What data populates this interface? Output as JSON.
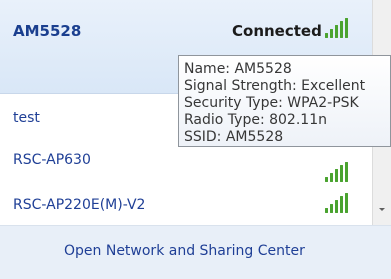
{
  "connected_network": {
    "name": "AM5528",
    "status": "Connected"
  },
  "tooltip": {
    "name": "Name: AM5528",
    "signal_strength": "Signal Strength: Excellent",
    "security_type": "Security Type: WPA2-PSK",
    "radio_type": "Radio Type: 802.11n",
    "ssid": "SSID: AM5528"
  },
  "networks": [
    {
      "name": "test"
    },
    {
      "name": "RSC-AP630"
    },
    {
      "name": "RSC-AP220E(M)-V2"
    }
  ],
  "footer": {
    "link_text": "Open Network and Sharing Center"
  },
  "icons": {
    "signal": "signal-strength-icon",
    "scroll": "chevron-down-icon"
  },
  "colors": {
    "link_blue": "#1f3f96",
    "signal_green": "#4aa32f",
    "highlight": "#d9e7f7"
  }
}
